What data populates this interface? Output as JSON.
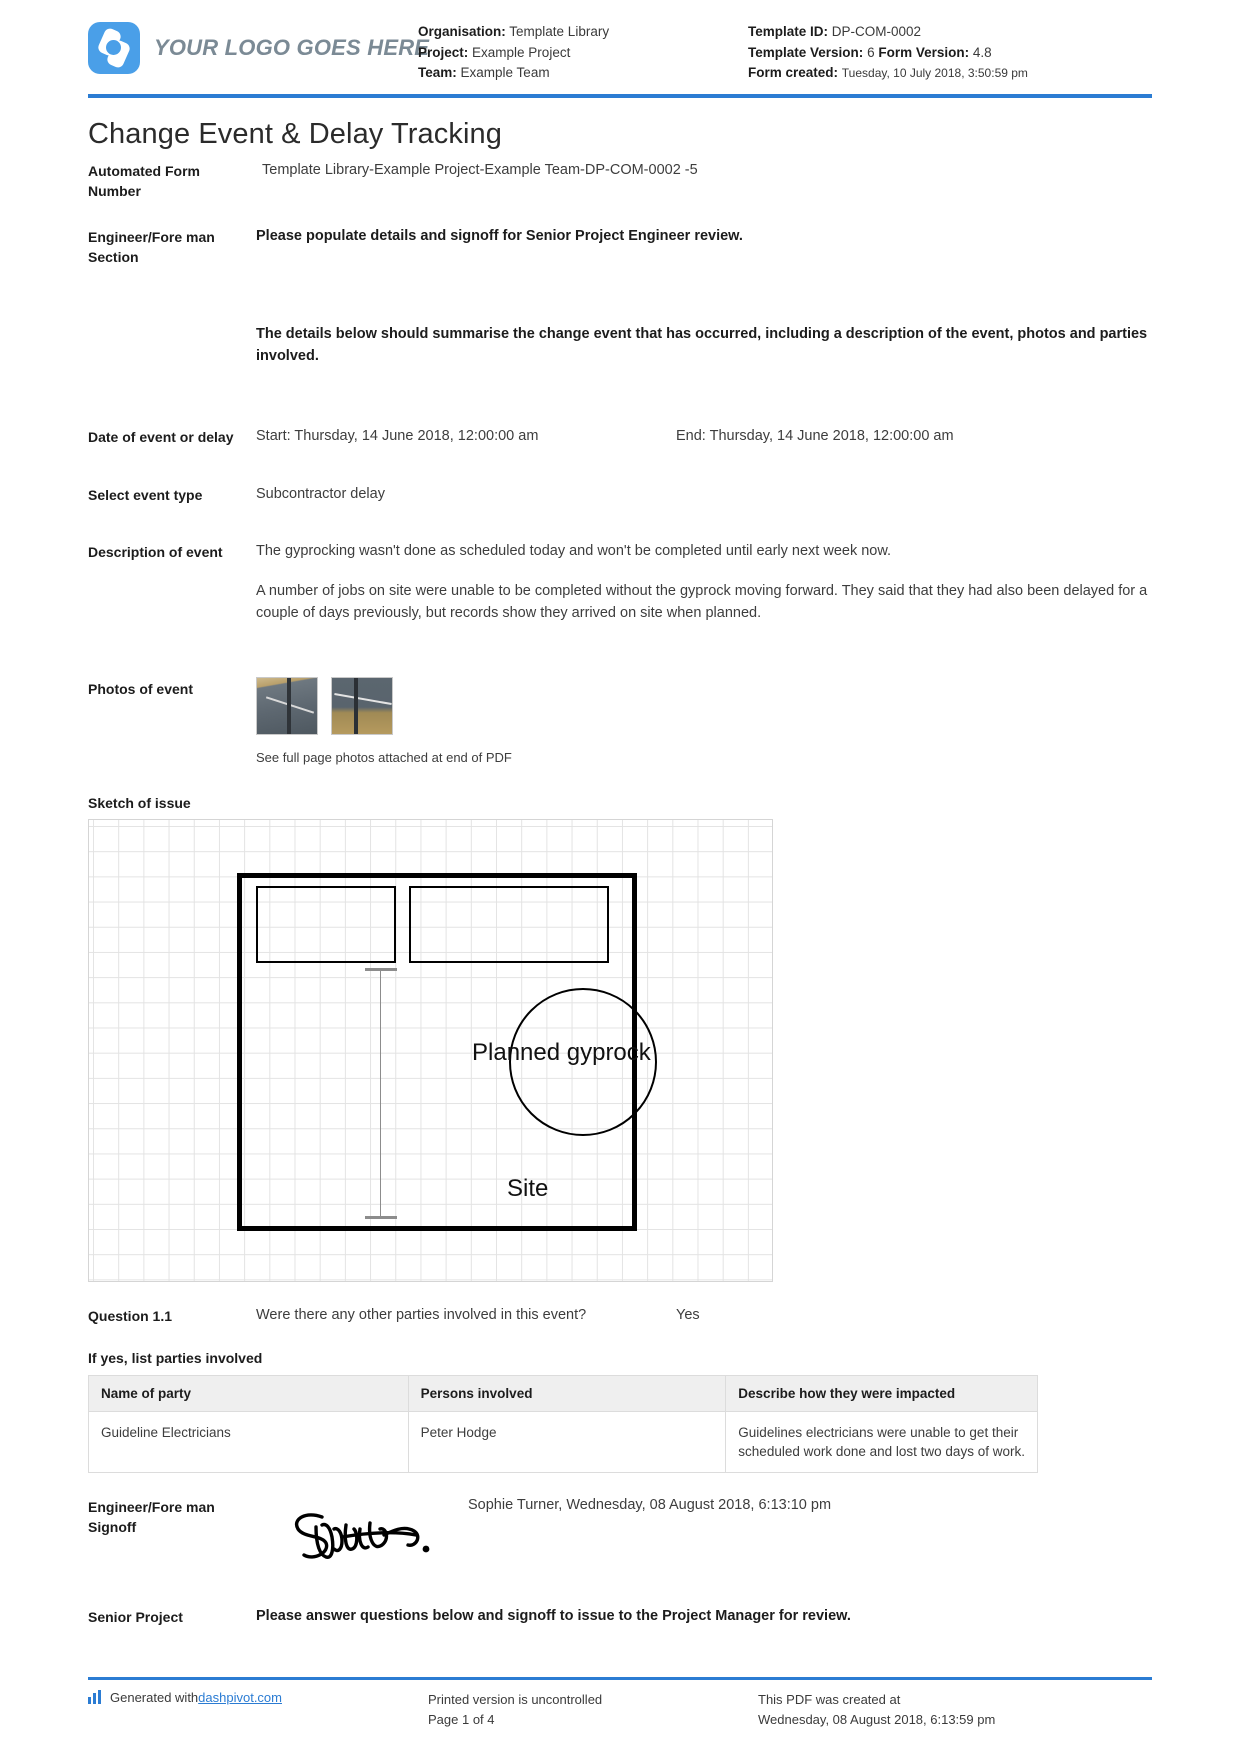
{
  "header": {
    "logo_text": "YOUR LOGO GOES HERE",
    "organisation_label": "Organisation:",
    "organisation_value": "Template Library",
    "project_label": "Project:",
    "project_value": "Example Project",
    "team_label": "Team:",
    "team_value": "Example Team",
    "template_id_label": "Template ID:",
    "template_id_value": "DP-COM-0002",
    "template_version_label": "Template Version:",
    "template_version_value": "6",
    "form_version_label": "Form Version:",
    "form_version_value": "4.8",
    "form_created_label": "Form created:",
    "form_created_value": "Tuesday, 10 July 2018, 3:50:59 pm"
  },
  "title": "Change Event & Delay Tracking",
  "form_number": {
    "label": "Automated Form Number",
    "value": "Template Library-Example Project-Example Team-DP-COM-0002   -5"
  },
  "engineer_section": {
    "label": "Engineer/Fore man Section",
    "instruction": "Please populate details and signoff for Senior Project Engineer review.",
    "summary": "The details below should summarise the change event that has occurred, including a description of the event, photos and parties involved."
  },
  "date_of_event": {
    "label": "Date of event or delay",
    "start": "Start: Thursday, 14 June 2018, 12:00:00 am",
    "end": "End: Thursday, 14 June 2018, 12:00:00 am"
  },
  "event_type": {
    "label": "Select event type",
    "value": "Subcontractor delay"
  },
  "description": {
    "label": "Description of event",
    "paragraph1": "The gyprocking wasn't done as scheduled today and won't be completed until early next week now.",
    "paragraph2": "A number of jobs on site were unable to be completed without the gyprock moving forward. They said that they had also been delayed for a couple of days previously, but records show they arrived on site when planned."
  },
  "photos": {
    "label": "Photos of event",
    "note": "See full page photos attached at end of PDF",
    "items": [
      "site-photo-1",
      "site-photo-2"
    ]
  },
  "sketch": {
    "label": "Sketch of issue",
    "annotation_1": "Planned gyprock",
    "annotation_2": "Site"
  },
  "question": {
    "label": "Question 1.1",
    "text": "Were there any other parties involved in this event?",
    "answer": "Yes"
  },
  "parties": {
    "subheading": "If yes, list parties involved",
    "columns": [
      "Name of party",
      "Persons involved",
      "Describe how they were impacted"
    ],
    "rows": [
      {
        "name": "Guideline Electricians",
        "persons": "Peter Hodge",
        "impact": "Guidelines electricians were unable to get their scheduled work done and lost two days of work."
      }
    ]
  },
  "signoff": {
    "label": "Engineer/Fore man Signoff",
    "value": "Sophie Turner, Wednesday, 08 August 2018, 6:13:10 pm",
    "signature_name": "signature-sophie"
  },
  "senior_project": {
    "label": "Senior Project",
    "instruction": "Please answer questions below and signoff to issue to the Project Manager for review."
  },
  "footer": {
    "generated_prefix": "Generated with ",
    "generated_link": "dashpivot.com",
    "printed_line1": "Printed version is uncontrolled",
    "printed_line2": "Page 1 of 4",
    "created_line1": "This PDF was created at",
    "created_line2": "Wednesday, 08 August 2018, 6:13:59 pm"
  },
  "colors": {
    "accent": "#2b7cd3",
    "logo": "#4a9fe8"
  }
}
